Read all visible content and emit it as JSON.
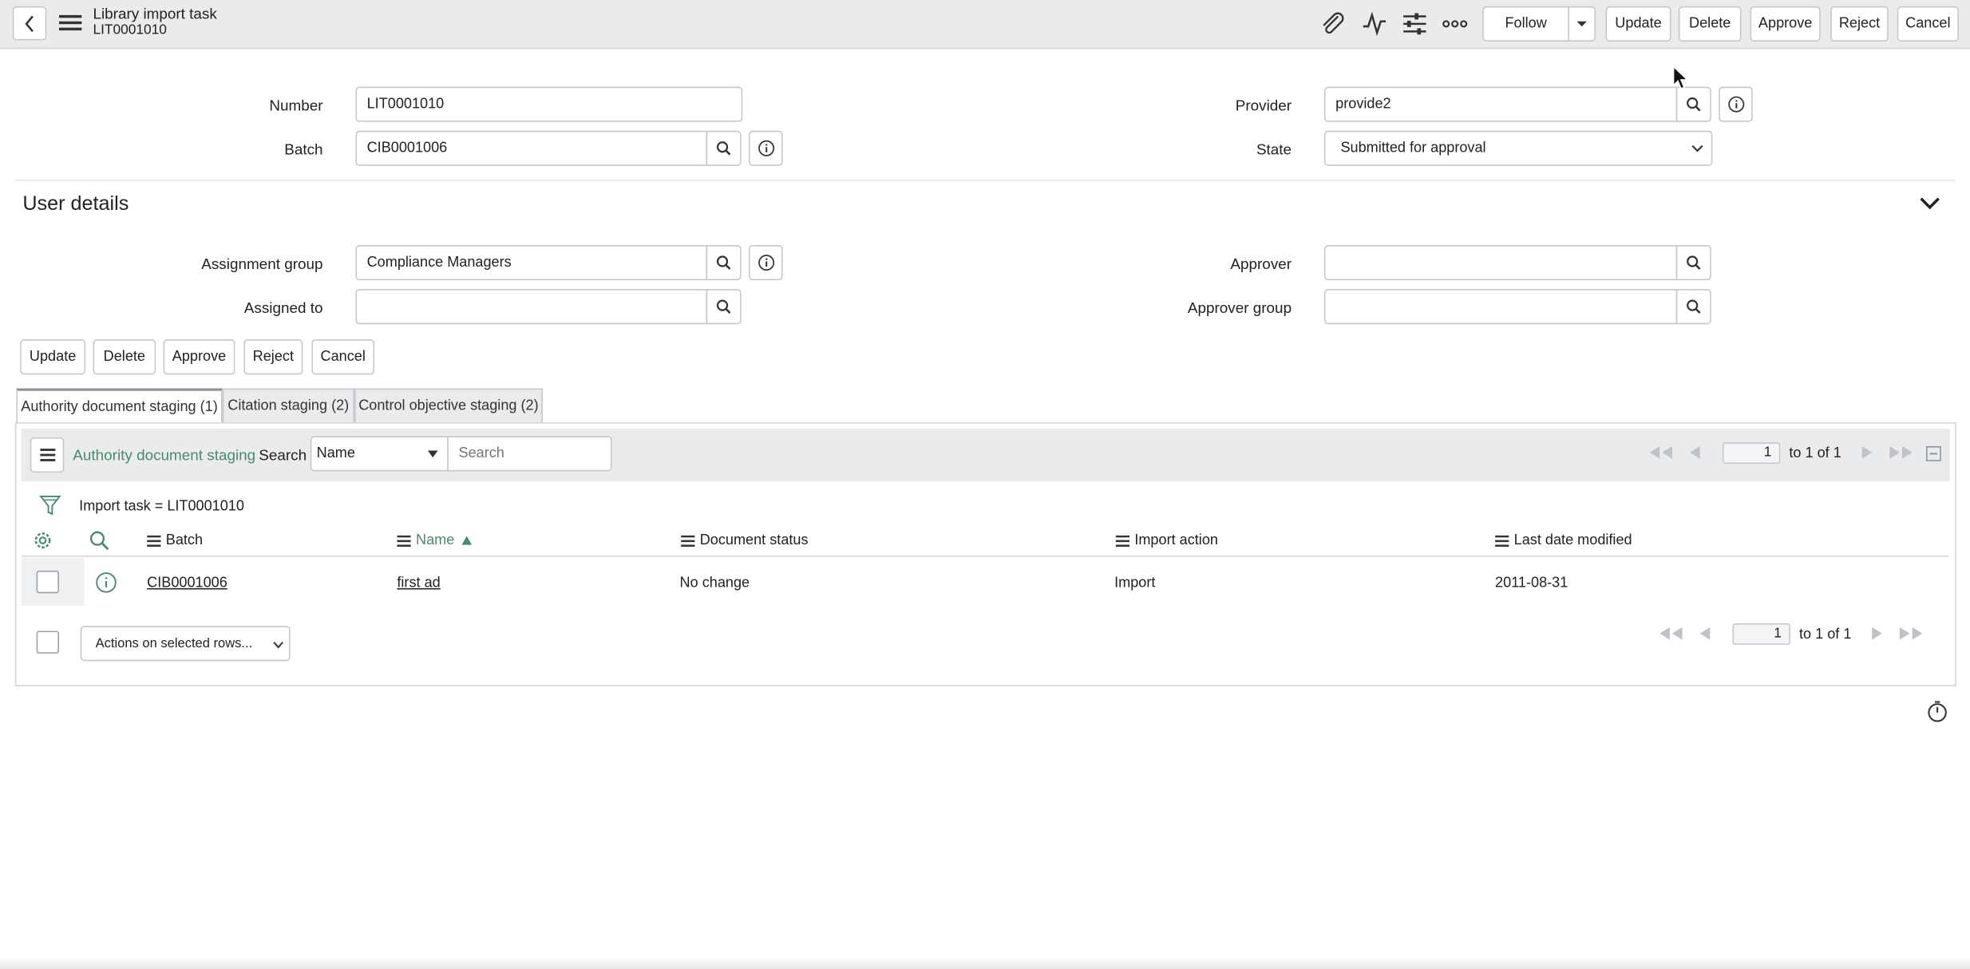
{
  "header": {
    "title": "Library import task",
    "subtitle": "LIT0001010",
    "buttons": {
      "follow": "Follow",
      "update": "Update",
      "delete": "Delete",
      "approve": "Approve",
      "reject": "Reject",
      "cancel": "Cancel"
    },
    "icons": [
      "back-icon",
      "menu-icon",
      "paperclip-icon",
      "activity-icon",
      "settings-sliders-icon",
      "more-icon"
    ]
  },
  "form": {
    "number": {
      "label": "Number",
      "value": "LIT0001010"
    },
    "batch": {
      "label": "Batch",
      "value": "CIB0001006"
    },
    "provider": {
      "label": "Provider",
      "value": "provide2"
    },
    "state": {
      "label": "State",
      "value": "Submitted for approval"
    }
  },
  "user_details": {
    "title": "User details",
    "assignment_group": {
      "label": "Assignment group",
      "value": "Compliance Managers"
    },
    "assigned_to": {
      "label": "Assigned to",
      "value": ""
    },
    "approver": {
      "label": "Approver",
      "value": ""
    },
    "approver_group": {
      "label": "Approver group",
      "value": ""
    }
  },
  "bottom_buttons": {
    "update": "Update",
    "delete": "Delete",
    "approve": "Approve",
    "reject": "Reject",
    "cancel": "Cancel"
  },
  "tabs": [
    {
      "label": "Authority document staging (1)",
      "active": true
    },
    {
      "label": "Citation staging (2)",
      "active": false
    },
    {
      "label": "Control objective staging (2)",
      "active": false
    }
  ],
  "related_list": {
    "title": "Authority document staging",
    "search_label": "Search",
    "search_field": "Name",
    "search_placeholder": "Search",
    "filter_text": "Import task = LIT0001010",
    "page_current": "1",
    "page_text": "to 1 of 1",
    "columns": [
      "Batch",
      "Name",
      "Document status",
      "Import action",
      "Last date modified"
    ],
    "sorted_column": "Name",
    "rows": [
      {
        "batch": "CIB0001006",
        "name": "first ad",
        "document_status": "No change",
        "import_action": "Import",
        "last_date_modified": "2011-08-31"
      }
    ],
    "actions_select": "Actions on selected rows..."
  },
  "colors": {
    "header_bg": "#e9ebec",
    "accent": "#4a8a6c",
    "border": "#c5c8cb"
  }
}
